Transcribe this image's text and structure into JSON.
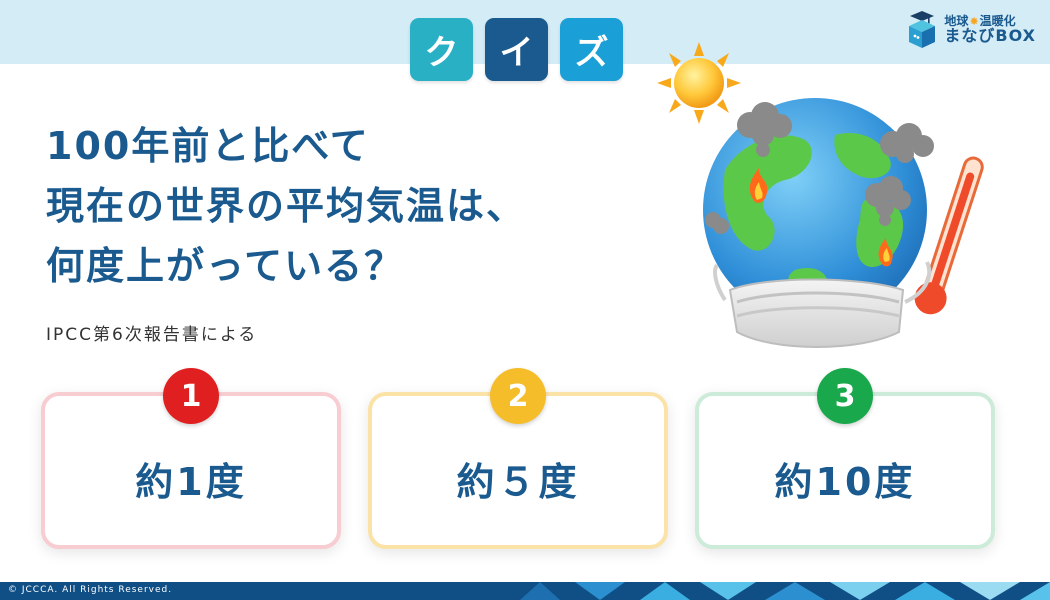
{
  "header": {
    "quiz_chars": [
      "ク",
      "イ",
      "ズ"
    ],
    "logo_line1_a": "地球",
    "logo_line1_b": "温暖化",
    "logo_line2": "まなびBOX"
  },
  "question": {
    "line1": "100年前と比べて",
    "line2": "現在の世界の平均気温は、",
    "line3": "何度上がっている？"
  },
  "source": "IPCC第6次報告書による",
  "options": [
    {
      "number": "1",
      "label": "約1度",
      "color": "#e02020"
    },
    {
      "number": "2",
      "label": "約５度",
      "color": "#f5bd2a"
    },
    {
      "number": "3",
      "label": "約10度",
      "color": "#1aa84c"
    }
  ],
  "footer": {
    "copyright": "© JCCCA. All Rights Reserved."
  },
  "colors": {
    "primary": "#1a5a8e",
    "header_bg": "#d4ecf6",
    "footer_bg": "#0f4f86"
  },
  "illustration": {
    "icons": [
      "sun-icon",
      "earth-icon",
      "smoke-icon",
      "fire-icon",
      "thermometer-icon",
      "face-mask-icon"
    ]
  }
}
